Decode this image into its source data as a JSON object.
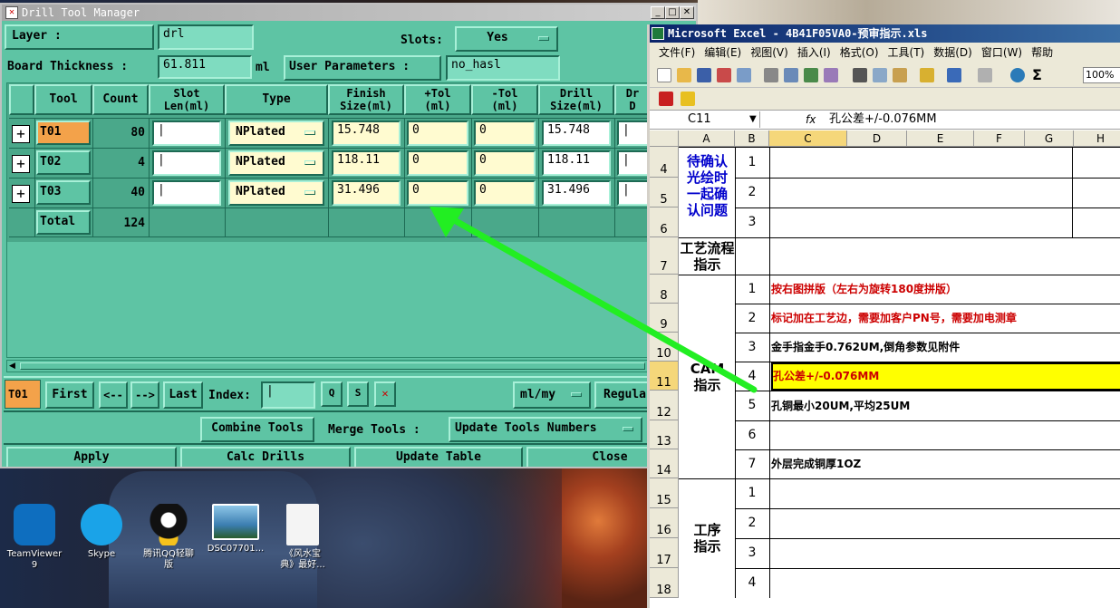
{
  "desktop": {
    "icons": [
      {
        "name": "teamviewer",
        "label": "TeamViewer\n9"
      },
      {
        "name": "skype",
        "label": "Skype"
      },
      {
        "name": "qq",
        "label": "腾讯QQ轻聊\n版"
      },
      {
        "name": "dsc",
        "label": "DSC07701..."
      },
      {
        "name": "doc",
        "label": "《风水宝\n典》最好..."
      }
    ]
  },
  "drill": {
    "title": "Drill Tool Manager",
    "layer_label": "Layer          :",
    "layer_value": "drl",
    "slots_label": "Slots:",
    "slots_value": "Yes",
    "board_label": "Board Thickness :",
    "board_value": "61.811",
    "board_unit": "ml",
    "user_params": "User Parameters :",
    "user_params_value": "no_hasl",
    "headers": [
      "Tool",
      "Count",
      "Slot\nLen(ml)",
      "Type",
      "Finish\nSize(ml)",
      "+Tol\n(ml)",
      "-Tol\n(ml)",
      "Drill\nSize(ml)",
      "Dr\nD"
    ],
    "rows": [
      {
        "tool": "T01",
        "count": "80",
        "type": "NPlated",
        "finish": "15.748",
        "ptol": "0",
        "mtol": "0",
        "drill": "15.748"
      },
      {
        "tool": "T02",
        "count": "4",
        "type": "NPlated",
        "finish": "118.11",
        "ptol": "0",
        "mtol": "0",
        "drill": "118.11"
      },
      {
        "tool": "T03",
        "count": "40",
        "type": "NPlated",
        "finish": "31.496",
        "ptol": "0",
        "mtol": "0",
        "drill": "31.496"
      }
    ],
    "total_label": "Total",
    "total_count": "124",
    "nav": {
      "current": "T01",
      "first": "First",
      "prev": "<--",
      "next": "-->",
      "last": "Last",
      "index_label": "Index:",
      "unit": "ml/my",
      "regula": "Regula"
    },
    "combine": "Combine Tools",
    "merge": "Merge Tools :",
    "update_nums": "Update Tools Numbers",
    "apply": "Apply",
    "calc": "Calc Drills",
    "update_table": "Update Table",
    "close": "Close"
  },
  "excel": {
    "title": "Microsoft Excel - 4B41F05VA0-预审指示.xls",
    "menu": [
      "文件(F)",
      "编辑(E)",
      "视图(V)",
      "插入(I)",
      "格式(O)",
      "工具(T)",
      "数据(D)",
      "窗口(W)",
      "帮助"
    ],
    "zoom": "100%",
    "name_box": "C11",
    "fx": "fx",
    "formula": "孔公差+/-0.076MM",
    "cols": [
      "A",
      "B",
      "C",
      "D",
      "E",
      "F",
      "G",
      "H"
    ],
    "rows": [
      "4",
      "5",
      "6",
      "7",
      "8",
      "9",
      "10",
      "11",
      "12",
      "13",
      "14",
      "15",
      "16",
      "17",
      "18"
    ],
    "a_confirm": "待确认\n光绘时\n一起确\n认问题",
    "a_process": "工艺流程\n指示",
    "a_cam": "CAM\n指示",
    "a_step": "工序\n指示",
    "b_vals": [
      "1",
      "2",
      "3",
      "",
      "1",
      "2",
      "3",
      "4",
      "5",
      "6",
      "7",
      "1",
      "2",
      "3",
      "4"
    ],
    "c_texts": [
      {
        "text": "按右图拼版（左右为旋转180度拼版）",
        "color": "#cc0000"
      },
      {
        "text": "标记加在工艺边，需要加客户PN号，需要加电测章",
        "color": "#cc0000"
      },
      {
        "text": "金手指金手0.762UM,倒角参数见附件",
        "color": "#000000"
      },
      {
        "text": "孔公差+/-0.076MM",
        "color": "#cc0000"
      },
      {
        "text": "孔铜最小20UM,平均25UM",
        "color": "#000000"
      },
      {
        "text": "",
        "color": "#000000"
      },
      {
        "text": "外层完成铜厚1OZ",
        "color": "#000000"
      }
    ],
    "highlight": "#ffff00"
  },
  "arrow_color": "#22ee22"
}
